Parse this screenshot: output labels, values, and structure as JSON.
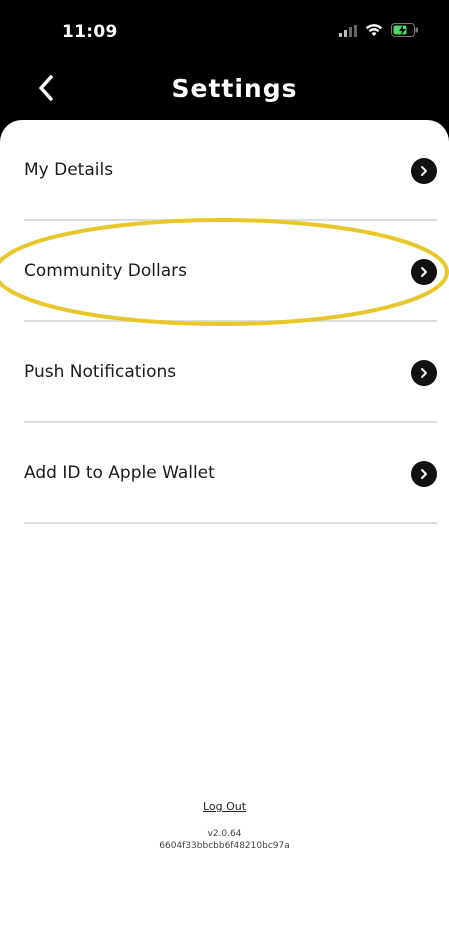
{
  "status_bar": {
    "time": "11:09",
    "signal_icon": "cellular-signal-icon",
    "wifi_icon": "wifi-icon",
    "battery_icon": "battery-charging-icon"
  },
  "header": {
    "title": "Settings",
    "back_icon": "chevron-left-icon"
  },
  "menu": {
    "items": [
      {
        "label": "My Details"
      },
      {
        "label": "Community Dollars",
        "highlighted": true
      },
      {
        "label": "Push Notifications"
      },
      {
        "label": "Add ID to Apple Wallet"
      }
    ]
  },
  "footer": {
    "logout_label": "Log Out",
    "version": "v2.0.64",
    "build_hash": "6604f33bbcbb6f48210bc97a"
  },
  "colors": {
    "header_bg": "#000000",
    "content_bg": "#ffffff",
    "highlight": "#e8c72a",
    "chevron_bg": "#111111"
  }
}
